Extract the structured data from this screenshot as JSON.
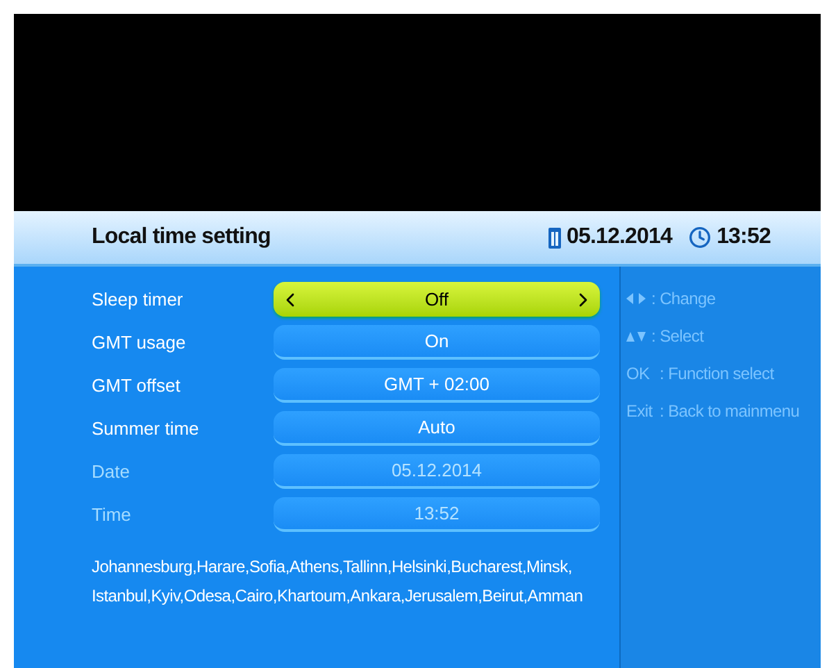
{
  "header": {
    "title": "Local time setting",
    "date": "05.12.2014",
    "time": "13:52"
  },
  "settings": [
    {
      "label": "Sleep timer",
      "value": "Off",
      "selected": true,
      "disabled": false
    },
    {
      "label": "GMT usage",
      "value": "On",
      "selected": false,
      "disabled": false
    },
    {
      "label": "GMT offset",
      "value": "GMT + 02:00",
      "selected": false,
      "disabled": false
    },
    {
      "label": "Summer time",
      "value": "Auto",
      "selected": false,
      "disabled": false
    },
    {
      "label": "Date",
      "value": "05.12.2014",
      "selected": false,
      "disabled": true
    },
    {
      "label": "Time",
      "value": "13:52",
      "selected": false,
      "disabled": true
    }
  ],
  "cities": "Johannesburg,Harare,Sofia,Athens,Tallinn,Helsinki,Bucharest,Minsk,Istanbul,Kyiv,Odesa,Cairo,Khartoum,Ankara,Jerusalem,Beirut,Amman",
  "help": [
    {
      "kind": "left-right",
      "action": ": Change"
    },
    {
      "kind": "up-down",
      "action": ": Select"
    },
    {
      "kind": "text",
      "key": "OK",
      "action": ": Function select"
    },
    {
      "kind": "text",
      "key": "Exit",
      "action": ": Back to mainmenu"
    }
  ]
}
